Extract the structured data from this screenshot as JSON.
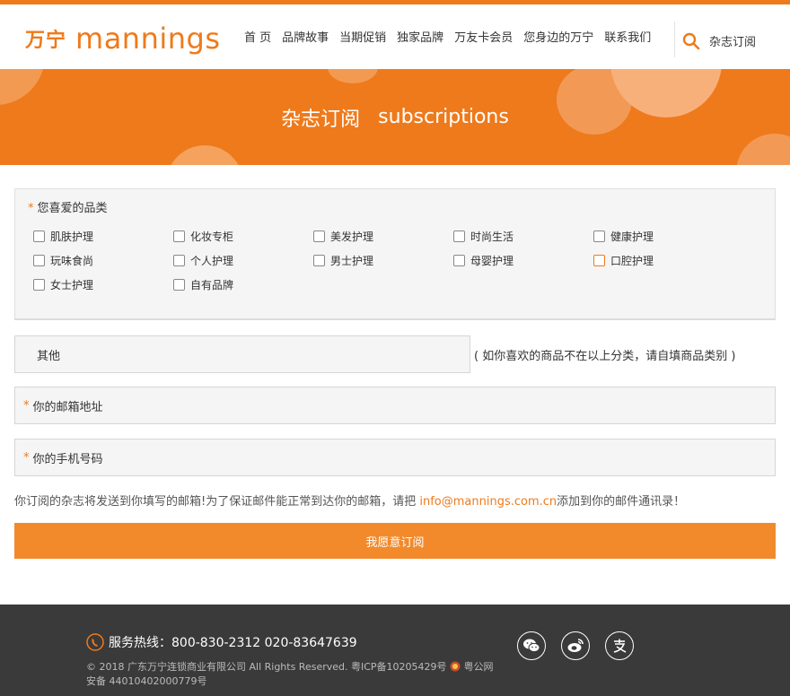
{
  "header": {
    "logo_cn": "万宁",
    "logo_en": "mannings",
    "nav": [
      "首 页",
      "品牌故事",
      "当期促销",
      "独家品牌",
      "万友卡会员",
      "您身边的万宁",
      "联系我们"
    ],
    "subscribe_link": "杂志订阅"
  },
  "banner": {
    "title_cn": "杂志订阅",
    "title_en": "subscriptions"
  },
  "form": {
    "category_label": "您喜爱的品类",
    "required_mark": "*",
    "categories": [
      "肌肤护理",
      "化妆专柜",
      "美发护理",
      "时尚生活",
      "健康护理",
      "玩味食尚",
      "个人护理",
      "男士护理",
      "母婴护理",
      "口腔护理",
      "女士护理",
      "自有品牌"
    ],
    "other_placeholder": "其他",
    "other_hint": "( 如你喜欢的商品不在以上分类，请自填商品类别 )",
    "email_placeholder": "你的邮箱地址",
    "phone_placeholder": "你的手机号码",
    "notice_before": "你订阅的杂志将发送到你填写的邮箱!为了保证邮件能正常到达你的邮箱，请把 ",
    "notice_email": "info@mannings.com.cn",
    "notice_after": "添加到你的邮件通讯录！",
    "submit_label": "我愿意订阅"
  },
  "footer": {
    "hotline": "服务热线：800-830-2312 020-83647639",
    "copyright": "© 2018 广东万宁连锁商业有限公司 All Rights Reserved. 粤ICP备10205429号",
    "police": "粤公网安备 44010402000779号",
    "social_icons": [
      "wechat-icon",
      "weibo-icon",
      "alipay-icon"
    ]
  },
  "colors": {
    "brand": "#ee7a1c",
    "button": "#f28a2c",
    "footer_bg": "#3a3a3a"
  }
}
